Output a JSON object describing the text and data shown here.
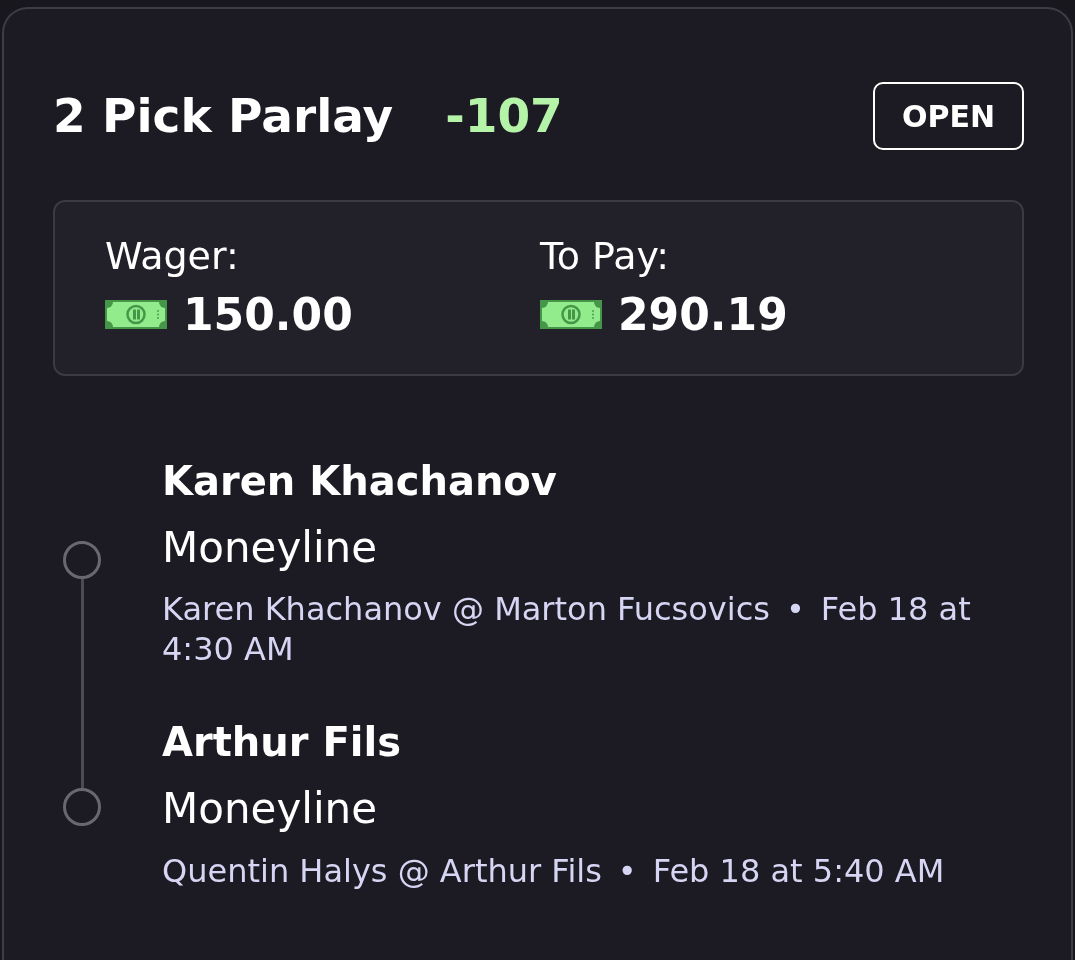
{
  "bet": {
    "title": "2 Pick Parlay",
    "odds": "-107",
    "status": "OPEN"
  },
  "summary": [
    {
      "label": "Wager:",
      "amount": "150.00"
    },
    {
      "label": "To Pay:",
      "amount": "290.19"
    }
  ],
  "legs": [
    {
      "selection": "Karen Khachanov",
      "market": "Moneyline",
      "matchup": "Karen Khachanov @ Marton Fucsovics",
      "separator": "•",
      "time": "Feb 18 at 4:30 AM"
    },
    {
      "selection": "Arthur Fils",
      "market": "Moneyline",
      "matchup": "Quentin Halys @ Arthur Fils",
      "separator": "•",
      "time": "Feb 18 at 5:40 AM"
    }
  ]
}
